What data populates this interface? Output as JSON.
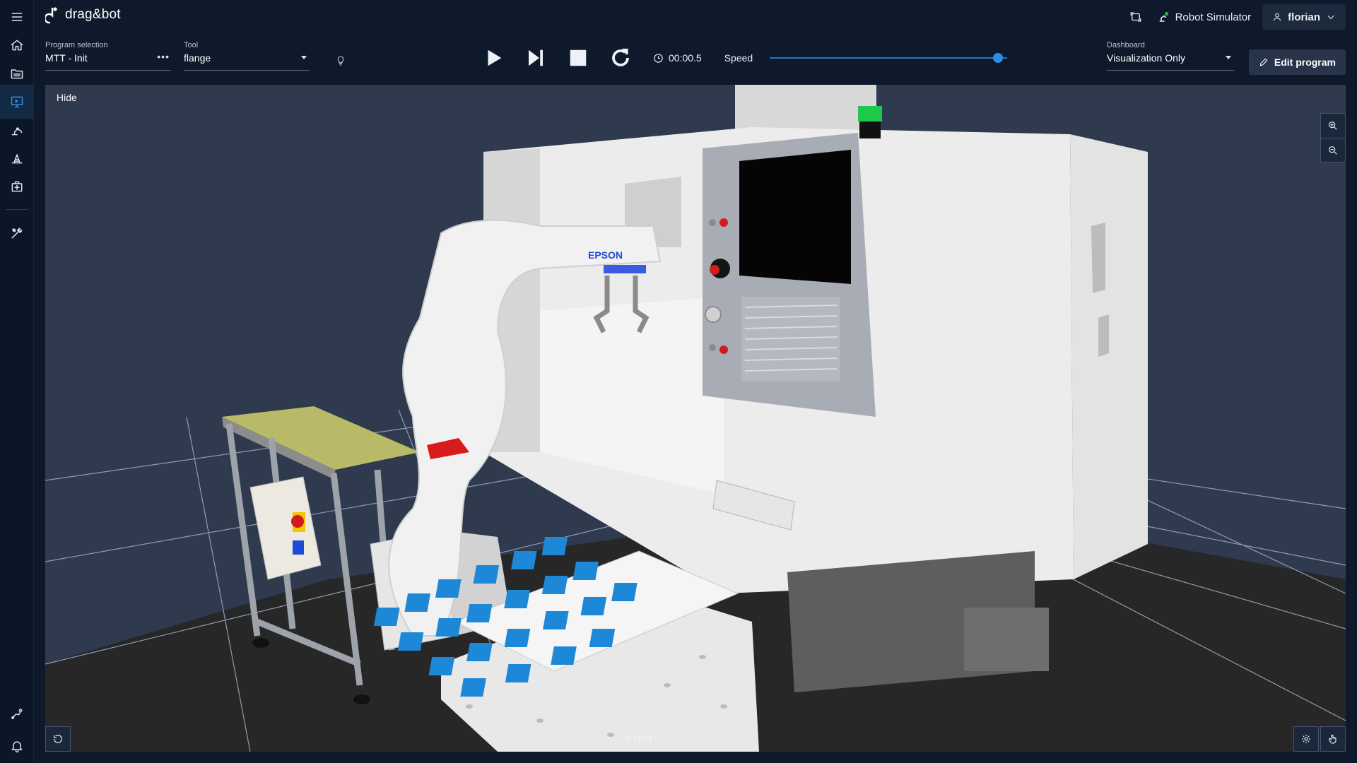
{
  "app": {
    "logo_text": "drag&bot"
  },
  "header": {
    "simulator_label": "Robot Simulator",
    "user_name": "florian"
  },
  "controls": {
    "program_selection": {
      "label": "Program selection",
      "value": "MTT - Init"
    },
    "tool": {
      "label": "Tool",
      "value": "flange"
    },
    "timer": "00:00.5",
    "speed_label": "Speed",
    "speed_fraction": 0.96,
    "dashboard": {
      "label": "Dashboard",
      "value": "Visualization Only"
    },
    "edit_button": "Edit program"
  },
  "viewport": {
    "hide_label": "Hide",
    "frame_label": "PTP-T",
    "robot_brand": "EPSON"
  },
  "colors": {
    "accent": "#2b8ee6",
    "sidebar_active": "#2f8fe0",
    "background": "#0e1a2b",
    "scene_bg": "#2f3a4f"
  }
}
